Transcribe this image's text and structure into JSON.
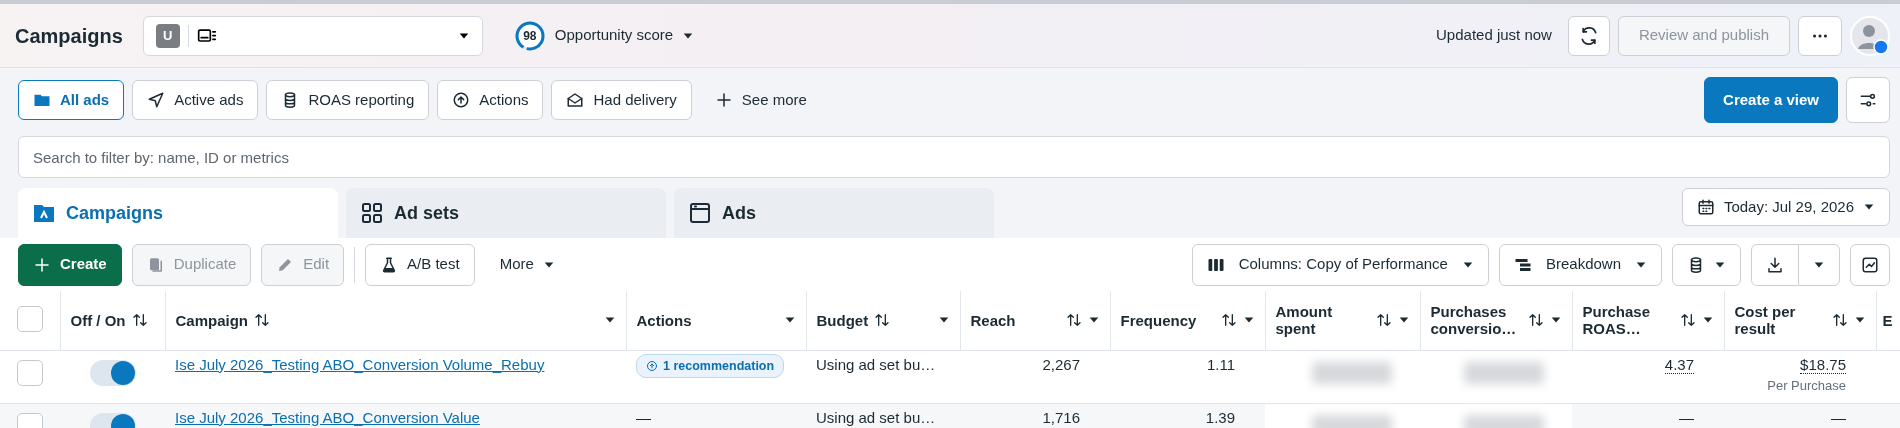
{
  "header": {
    "title": "Campaigns",
    "account": {
      "initial": "U"
    },
    "opportunity": {
      "score": "98",
      "label": "Opportunity score",
      "level": 0.95
    },
    "updated": "Updated just now",
    "review_button": {
      "label": "Review and publish",
      "disabled": true
    }
  },
  "views": [
    {
      "label": "All ads",
      "selected": true
    },
    {
      "label": "Active ads",
      "selected": false
    },
    {
      "label": "ROAS reporting",
      "selected": false
    },
    {
      "label": "Actions",
      "selected": false
    },
    {
      "label": "Had delivery",
      "selected": false
    }
  ],
  "see_more": "See more",
  "create_view": "Create a view",
  "search": {
    "placeholder": "Search to filter by: name, ID or metrics"
  },
  "level_tabs": [
    {
      "label": "Campaigns",
      "selected": true
    },
    {
      "label": "Ad sets",
      "selected": false
    },
    {
      "label": "Ads",
      "selected": false
    }
  ],
  "date": "Today: Jul 29, 2026",
  "toolbar": {
    "buttons": [
      {
        "label": "Create",
        "kind": "primary",
        "disabled": false
      },
      {
        "label": "Duplicate",
        "kind": "duplicate",
        "disabled": true
      },
      {
        "label": "Edit",
        "kind": "edit",
        "disabled": true
      },
      {
        "label": "A/B test",
        "kind": "flask",
        "disabled": false
      },
      {
        "label": "More",
        "kind": "menu",
        "disabled": false
      }
    ],
    "columns": "Columns: Copy of Performance",
    "breakdown": "Breakdown"
  },
  "table": {
    "all_checked": false,
    "columns": [
      {
        "label": "Off / On",
        "sortable": true,
        "menu": false
      },
      {
        "label": "Campaign",
        "sortable": true,
        "menu": true
      },
      {
        "label": "Actions",
        "sortable": false,
        "menu": true
      },
      {
        "label": "Budget",
        "sortable": true,
        "menu": true
      },
      {
        "label": "Reach",
        "sortable": true,
        "menu": true
      },
      {
        "label": "Frequency",
        "sortable": true,
        "menu": true
      },
      {
        "label": "Amount spent",
        "sortable": true,
        "menu": true
      },
      {
        "label": "Purchases conversio…",
        "sortable": true,
        "menu": true
      },
      {
        "label": "Purchase ROAS…",
        "sortable": true,
        "menu": true
      },
      {
        "label": "Cost per result",
        "sortable": true,
        "menu": true
      },
      {
        "label": "E",
        "sortable": false,
        "menu": false
      }
    ],
    "rows": [
      {
        "checked": false,
        "on": true,
        "campaign": "Ise July 2026_Testing ABO_Conversion Volume_Rebuy",
        "action": {
          "kind": "recommendation",
          "text": "1 recommendation"
        },
        "budget": "Using ad set bu…",
        "reach": "2,267",
        "frequency": "1.11",
        "amount_spent": {
          "redacted": true
        },
        "purchases": {
          "redacted": true
        },
        "roas": "4.37",
        "cost": "$18.75",
        "cost_note": "Per Purchase"
      },
      {
        "checked": false,
        "on": true,
        "campaign": "Ise July 2026_Testing ABO_Conversion Value",
        "action": {
          "kind": "text",
          "text": "—"
        },
        "budget": "Using ad set bu…",
        "reach": "1,716",
        "frequency": "1.39",
        "amount_spent": {
          "redacted": true
        },
        "purchases": {
          "redacted": true
        },
        "roas": "—",
        "cost": "—"
      }
    ]
  }
}
